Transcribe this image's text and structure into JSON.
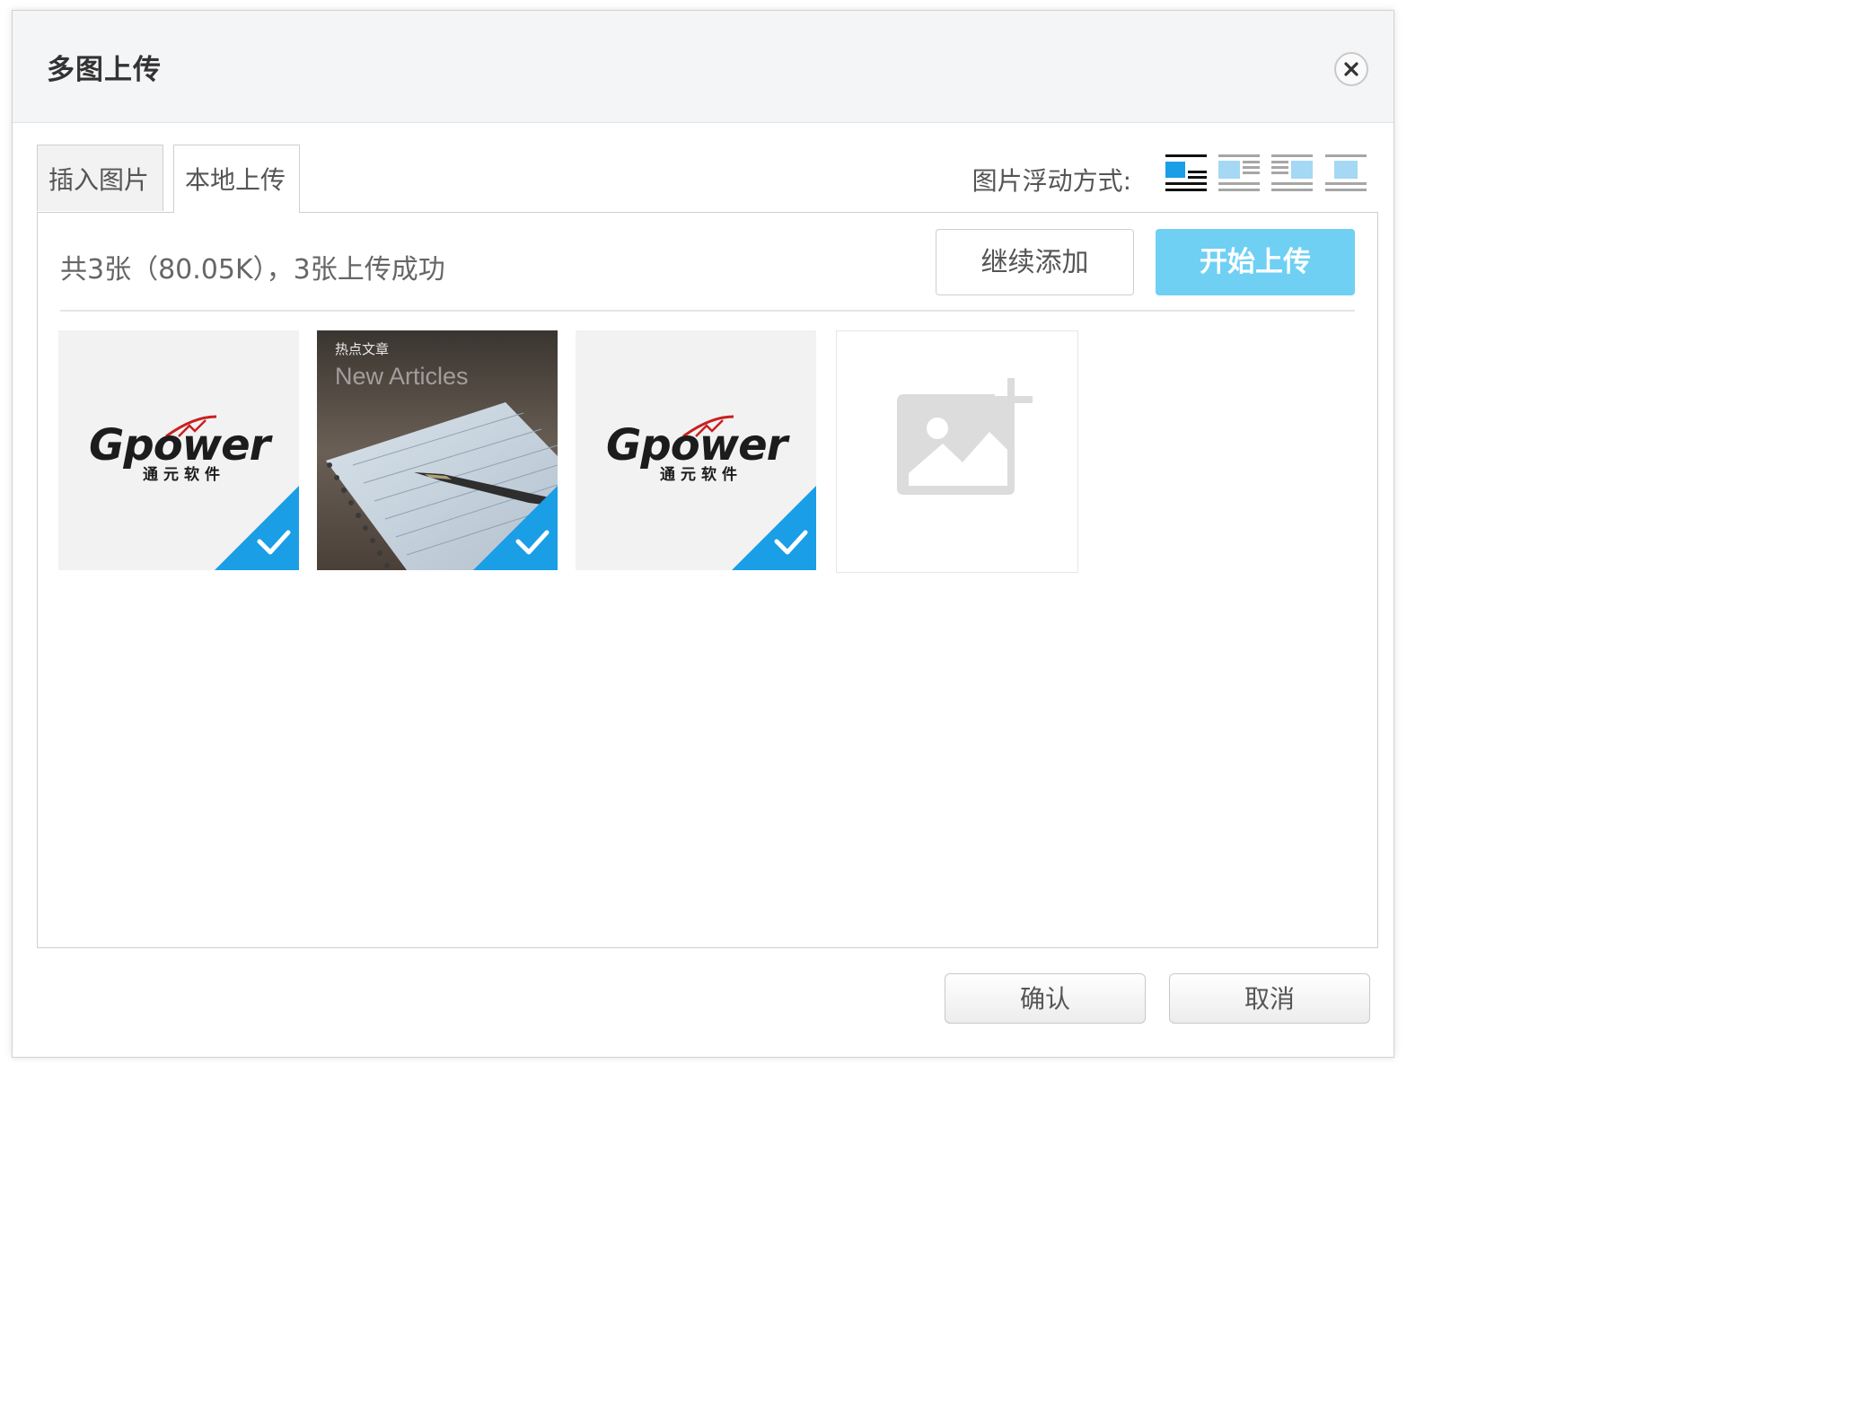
{
  "dialog": {
    "title": "多图上传"
  },
  "tabs": [
    {
      "label": "插入图片"
    },
    {
      "label": "本地上传"
    }
  ],
  "float": {
    "label": "图片浮动方式:",
    "options": [
      "float-none-icon",
      "float-left-icon",
      "float-right-icon",
      "float-center-icon"
    ],
    "active_color": "#1a9ee6",
    "inactive_color": "#a4d8f4"
  },
  "upload": {
    "status": "共3张（80.05K），3张上传成功",
    "continue_label": "继续添加",
    "start_label": "开始上传",
    "start_color": "#6fd0f4",
    "check_color": "#1a9ee6"
  },
  "thumbnails": [
    {
      "logo": "Gpower",
      "logo_sub": "通元软件"
    },
    {
      "heading": "热点文章",
      "subheading": "New Articles"
    },
    {
      "logo": "Gpower",
      "logo_sub": "通元软件"
    }
  ],
  "footer": {
    "ok_label": "确认",
    "cancel_label": "取消"
  }
}
